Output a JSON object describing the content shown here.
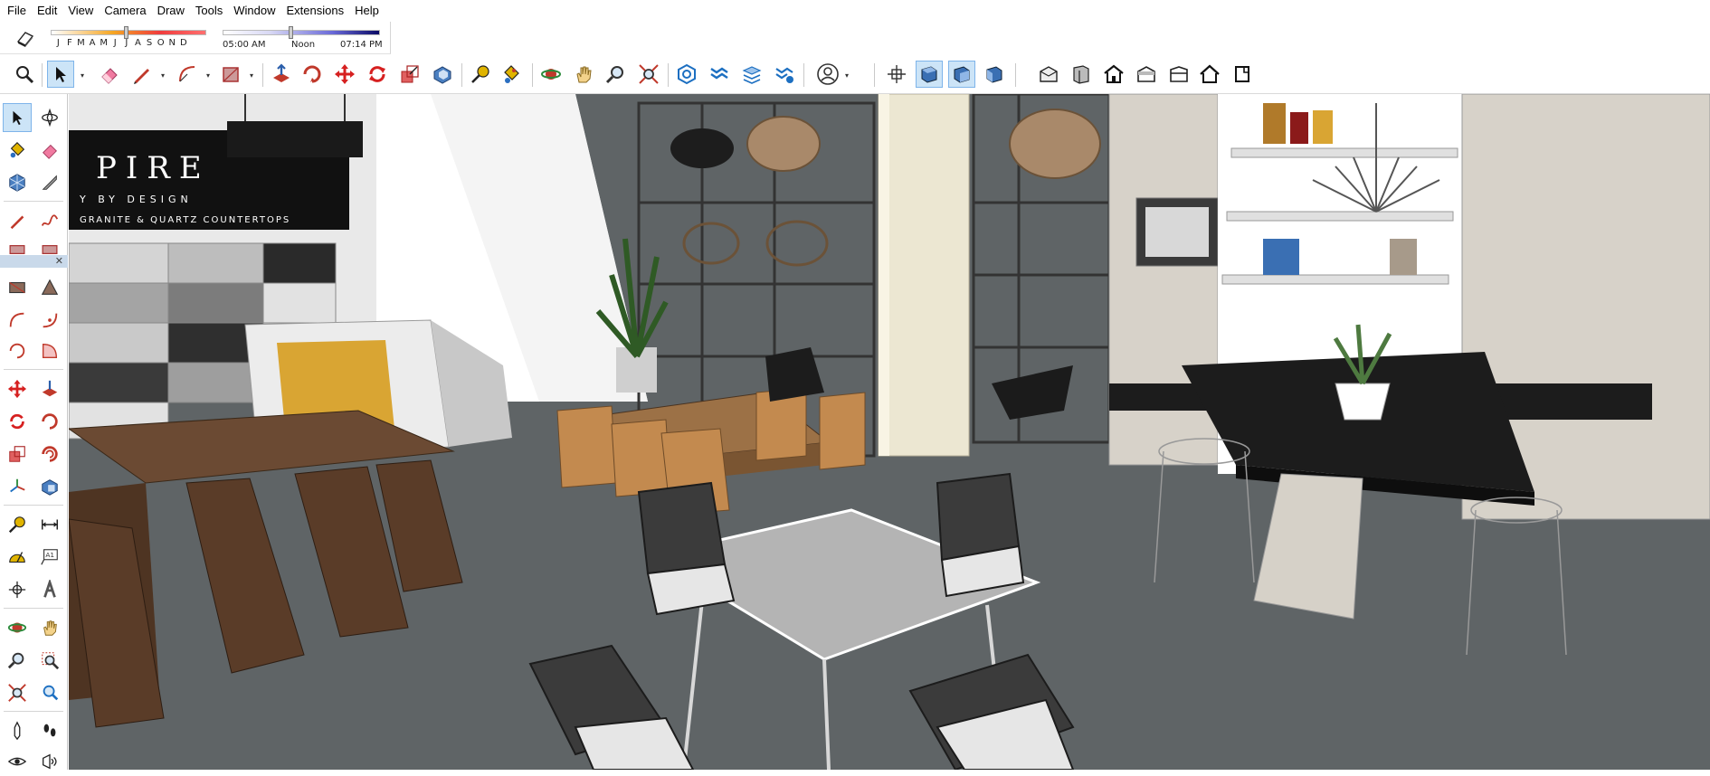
{
  "menu": {
    "items": [
      "File",
      "Edit",
      "View",
      "Camera",
      "Draw",
      "Tools",
      "Window",
      "Extensions",
      "Help"
    ]
  },
  "shadows": {
    "months": [
      "J",
      "F",
      "M",
      "A",
      "M",
      "J",
      "J",
      "A",
      "S",
      "O",
      "N",
      "D"
    ],
    "month_position": 0.47,
    "time_start": "05:00 AM",
    "time_noon": "Noon",
    "time_end": "07:14 PM",
    "time_position": 0.42
  },
  "toolbar": {
    "icons": [
      "zoom-icon",
      "select-icon",
      "eraser-icon",
      "pencil-line-icon",
      "arc-icon",
      "rectangle-icon",
      "push-pull-icon",
      "follow-me-icon",
      "move-icon",
      "rotate-icon",
      "scale-icon",
      "offset-icon",
      "tape-measure-icon",
      "paint-bucket-icon",
      "orbit-icon",
      "pan-icon",
      "zoom-tool-icon",
      "zoom-extents-icon",
      "warehouse-icon",
      "extension-warehouse-icon",
      "layout-icon",
      "extension-manager-icon",
      "account-icon",
      "iso-view-icon",
      "top-view-icon",
      "front-view-icon",
      "right-view-icon",
      "back-view-icon",
      "left-view-icon",
      "xray-style-icon",
      "wireframe-style-icon",
      "hidden-line-style-icon",
      "shaded-style-icon",
      "textured-style-icon",
      "monochrome-style-icon"
    ]
  },
  "left_tools": {
    "icons": [
      "select-icon",
      "orbit-icon",
      "paint-bucket-icon",
      "eraser-icon",
      "component-icon",
      "tape-measure-icon",
      "line-icon",
      "freehand-icon",
      "rectangle-icon",
      "rotated-rectangle-icon",
      "arc-icon",
      "two-point-arc-icon",
      "three-point-arc-icon",
      "pie-icon",
      "move-icon",
      "push-pull-icon",
      "rotate-icon",
      "follow-me-icon",
      "scale-icon",
      "offset-icon",
      "axes-icon",
      "dimension-icon",
      "text-icon",
      "protractor-icon",
      "3d-text-icon",
      "position-camera-icon",
      "look-around-icon",
      "orbit-tool-icon",
      "pan-tool-icon",
      "zoom-tool-icon",
      "zoom-window-icon",
      "zoom-extents-icon",
      "previous-view-icon",
      "walk-icon",
      "section-plane-icon",
      "display-section-icon"
    ]
  },
  "scene": {
    "sign_text_main": "PIRE",
    "sign_text_sub": "Y BY DESIGN",
    "sign_text_bottom": "GRANITE & QUARTZ COUNTERTOPS"
  },
  "colors": {
    "accent": "#0078d7",
    "floor": "#5f6466",
    "wood": "#6b4a33",
    "chair_wood": "#b98a52",
    "counter_black": "#1c1c1c"
  }
}
